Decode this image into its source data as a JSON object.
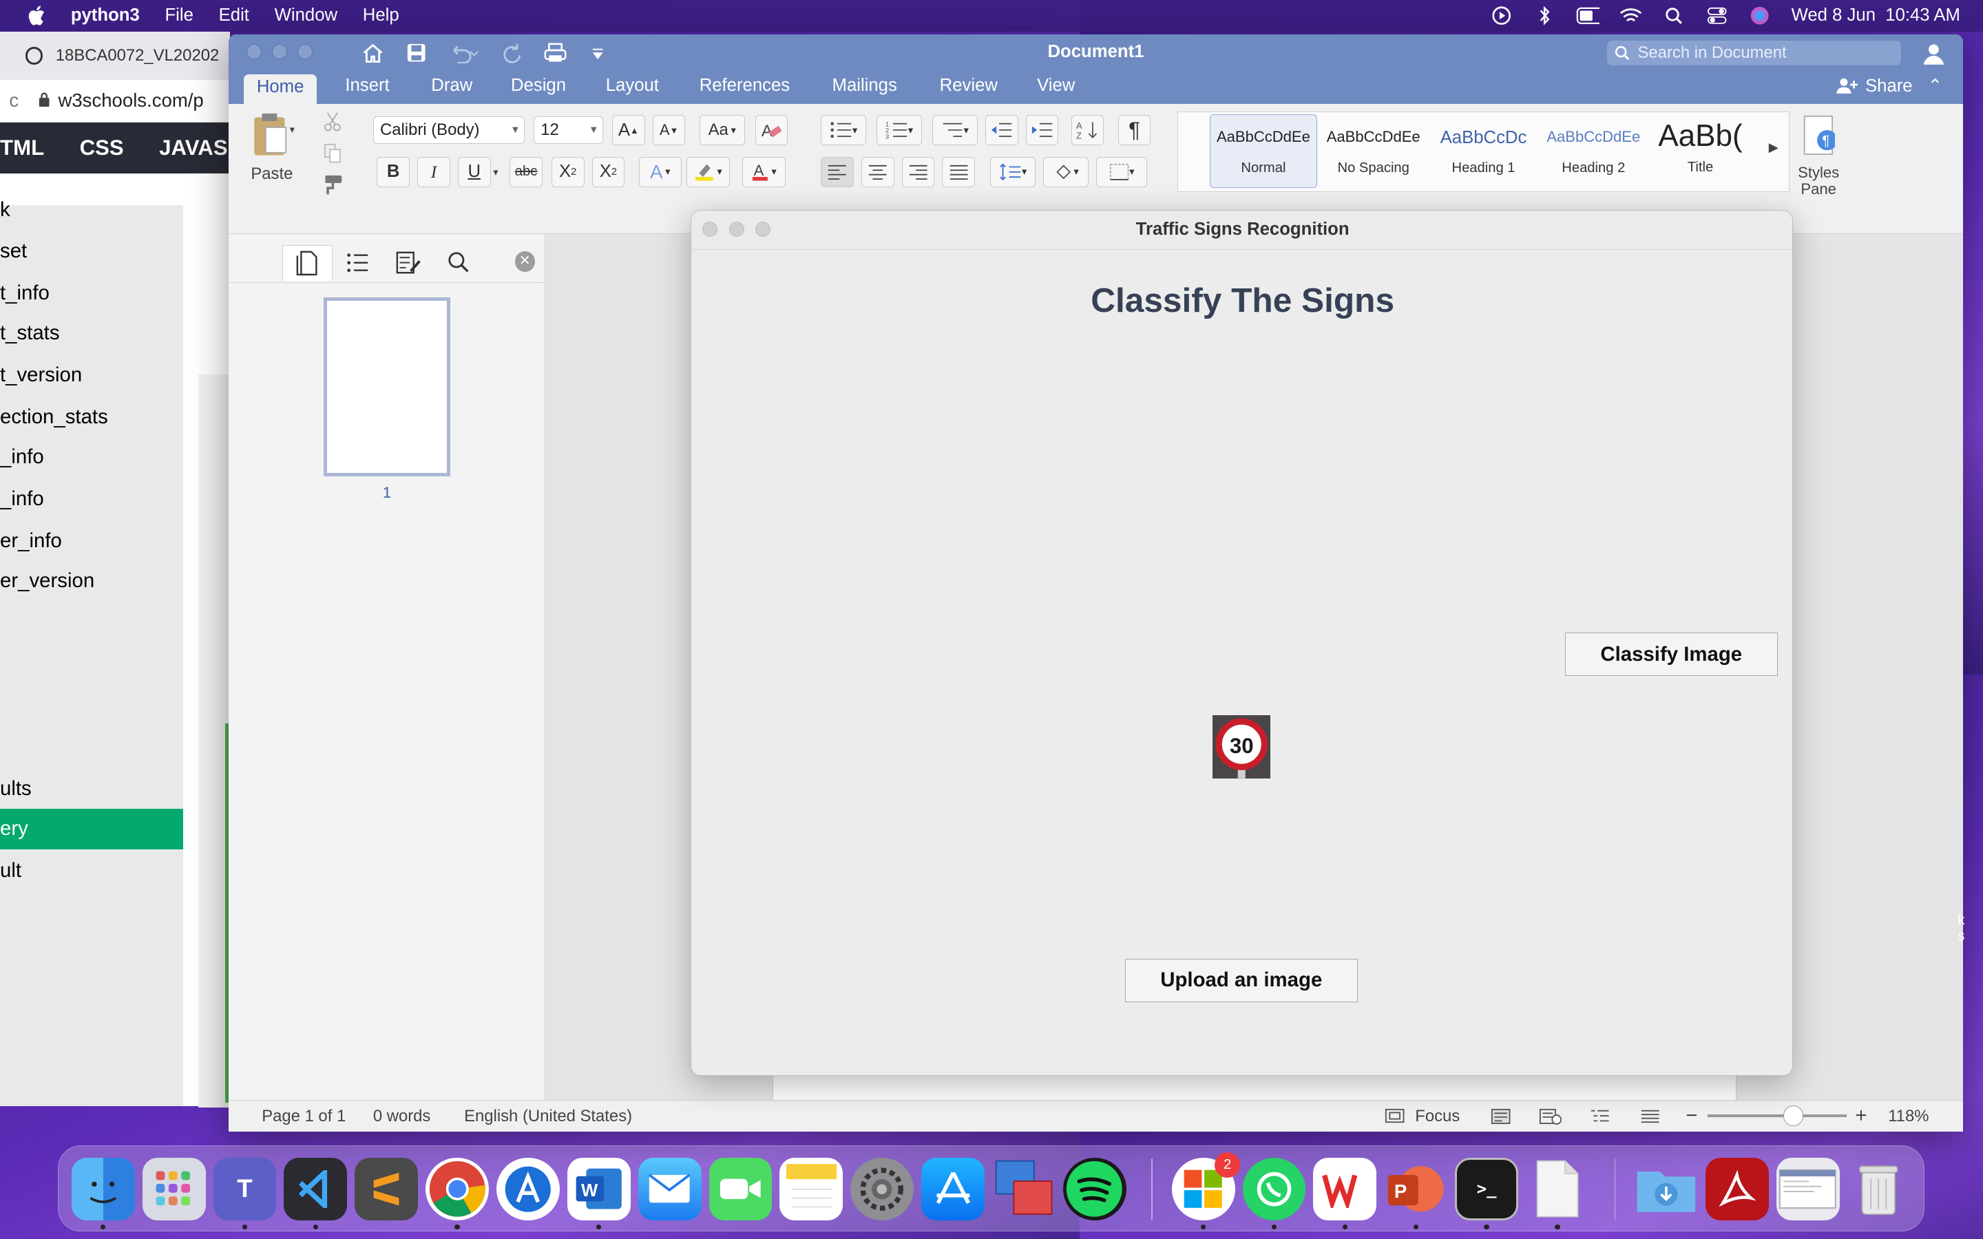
{
  "menubar": {
    "app": "python3",
    "items": [
      "File",
      "Edit",
      "Window",
      "Help"
    ],
    "clock": "Wed 8 Jun  10:43 AM"
  },
  "browser": {
    "tab_title": "18BCA0072_VL20202",
    "url": "w3schools.com/p",
    "topnav": [
      "TML",
      "CSS",
      "JAVAS"
    ],
    "sidenav": [
      "k",
      "set",
      "t_info",
      "t_stats",
      "t_version",
      "ection_stats",
      "_info",
      "_info",
      "er_info",
      "er_version",
      "ults",
      "ery",
      "ult"
    ],
    "active_index": 11
  },
  "word": {
    "doc_title": "Document1",
    "search_placeholder": "Search in Document",
    "tabs": [
      "Home",
      "Insert",
      "Draw",
      "Design",
      "Layout",
      "References",
      "Mailings",
      "Review",
      "View"
    ],
    "share": "Share",
    "paste": "Paste",
    "font_name": "Calibri (Body)",
    "font_size": "12",
    "styles": [
      {
        "sample": "AaBbCcDdEe",
        "name": "Normal"
      },
      {
        "sample": "AaBbCcDdEe",
        "name": "No Spacing"
      },
      {
        "sample": "AaBbCcDc",
        "name": "Heading 1"
      },
      {
        "sample": "AaBbCcDdEe",
        "name": "Heading 2"
      },
      {
        "sample": "AaBb(",
        "name": "Title"
      }
    ],
    "styles_pane": "Styles\nPane",
    "page_number": "1",
    "status": {
      "page": "Page 1 of 1",
      "words": "0 words",
      "language": "English (United States)",
      "focus": "Focus",
      "zoom": "118%"
    },
    "zoom_level": 0.62
  },
  "tk": {
    "title": "Traffic Signs Recognition",
    "heading": "Classify The Signs",
    "classify_button": "Classify Image",
    "upload_button": "Upload an image",
    "sign_text": "30"
  },
  "dock": {
    "apps": [
      "Finder",
      "Launchpad",
      "Teams",
      "VS Code",
      "Sublime Text",
      "Chrome",
      "Xcode",
      "Word",
      "Mail",
      "FaceTime",
      "Notes",
      "System Preferences",
      "App Store",
      "Remote Desktop",
      "Spotify",
      "Microsoft Office",
      "WhatsApp",
      "WPS Office",
      "PowerPoint",
      "Terminal",
      "Document",
      "Downloads",
      "Acrobat",
      "Screenshot",
      "Trash"
    ],
    "badge": "2"
  },
  "colors": {
    "word_accent": "#6e8ac0",
    "w3_green": "#04aa6d",
    "tk_heading": "#364156"
  }
}
